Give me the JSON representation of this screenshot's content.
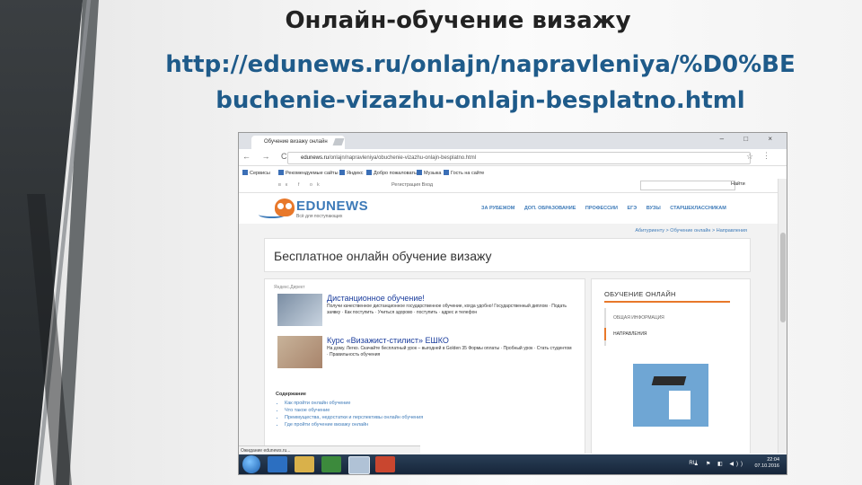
{
  "slide": {
    "title": "Онлайн-обучение визажу",
    "url_line1": "http://edunews.ru/onlajn/napravleniya/%D0%BE",
    "url_line2": "buchenie-vizazhu-onlajn-besplatno.html"
  },
  "browser": {
    "tab_title": "Обучение визажу онлайн",
    "tab_close": "×",
    "window_controls": "– □ ×",
    "nav": "← → C",
    "url_host": "edunews.ru",
    "url_path": "/onlajn/napravleniya/obuchenie-vizazhu-onlajn-besplatno.html",
    "star": "☆",
    "menu": "⋮",
    "bookmarks": [
      "Сервисы",
      "Рекомендуемые сайты",
      "Яндекс",
      "Добро пожаловать...",
      "Музыка",
      "Гость на сайте"
    ]
  },
  "site": {
    "social": "вк f ok",
    "login_links": "Регистрация   Вход",
    "search_button": "Найти",
    "logo_text": "EDUNEWS",
    "logo_sub": "Всё для поступающих",
    "nav": [
      "ЗА РУБЕЖОМ",
      "ДОП. ОБРАЗОВАНИЕ",
      "ПРОФЕССИИ",
      "ЕГЭ",
      "ВУЗЫ",
      "СТАРШЕКЛАССНИКАМ"
    ],
    "breadcrumb": "Абитуриенту > Обучение онлайн > Направления",
    "page_title": "Бесплатное онлайн обучение визажу",
    "ydirect": "Яндекс.Директ",
    "ads": [
      {
        "title": "Дистанционное обучение!",
        "text": "Получи качественное дистанционное государственное обучение, когда удобно! Государственный диплом · Подать заявку · Как поступить · Учиться здорово · поступить · адрес и телефон"
      },
      {
        "title": "Курс «Визажист-стилист» ЕШКО",
        "text": "На дому. Легко. Скачайте бесплатный урок – выгодней в Gоlden 35 Формы оплаты · Пробный урок · Стать студентом · Правильность обучения"
      }
    ],
    "toc_title": "Содержание",
    "toc": [
      "Как пройти онлайн обучение",
      "Что такое обучение",
      "Преимущества, недостатки и перспективы онлайн обучения",
      "Где пройти обучение визажу онлайн"
    ],
    "side_title": "ОБУЧЕНИЕ ОНЛАЙН",
    "side_tab1": "ОБЩАЯ ИНФОРМАЦИЯ",
    "side_tab2": "НАПРАВЛЕНИЯ",
    "status_tip": "Ожидание edunews.ru..."
  },
  "taskbar": {
    "lang": "RU",
    "tray_icons": "▲ ⚑ ◧ ◀))",
    "time": "22:04",
    "date": "07.10.2016"
  }
}
